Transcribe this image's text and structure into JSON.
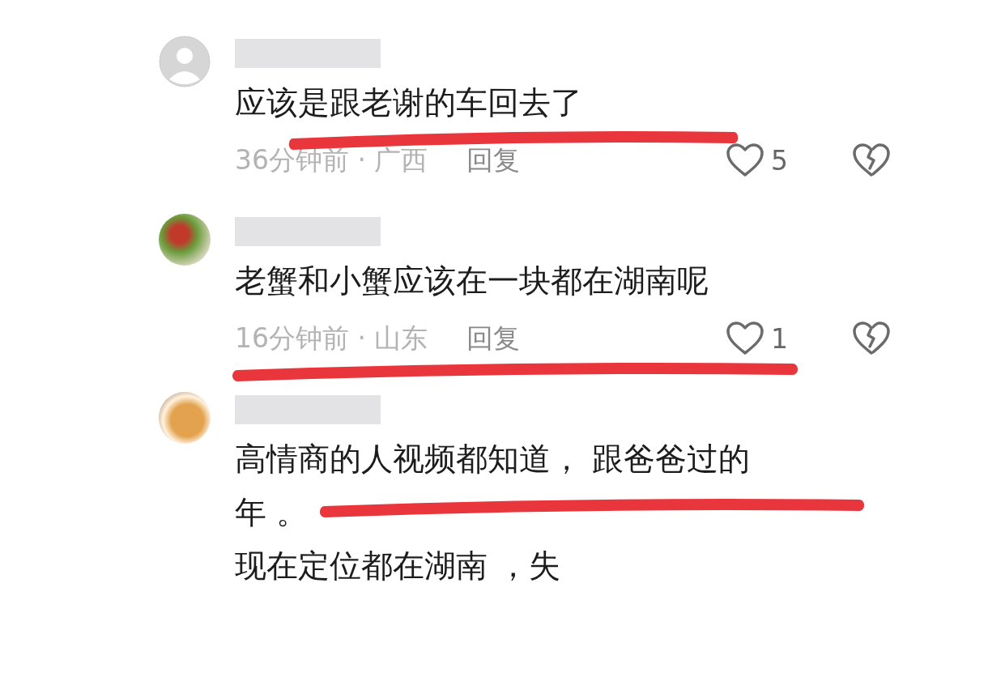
{
  "comments": [
    {
      "avatar": {
        "kind": "default"
      },
      "lines": [
        "应该是跟老谢的车回去了"
      ],
      "meta": "36分钟前 · 广西",
      "reply": "回复",
      "likes": "5",
      "underline": true
    },
    {
      "avatar": {
        "kind": "photo"
      },
      "lines": [
        "老蟹和小蟹应该在一块都在湖南呢"
      ],
      "meta": "16分钟前 · 山东",
      "reply": "回复",
      "likes": "1",
      "underline": true
    },
    {
      "avatar": {
        "kind": "cartoon"
      },
      "lines": [
        "高情商的人视频都知道， 跟爸爸过的",
        "年 。",
        "现在定位都在湖南 ，失"
      ],
      "underline": true
    }
  ]
}
